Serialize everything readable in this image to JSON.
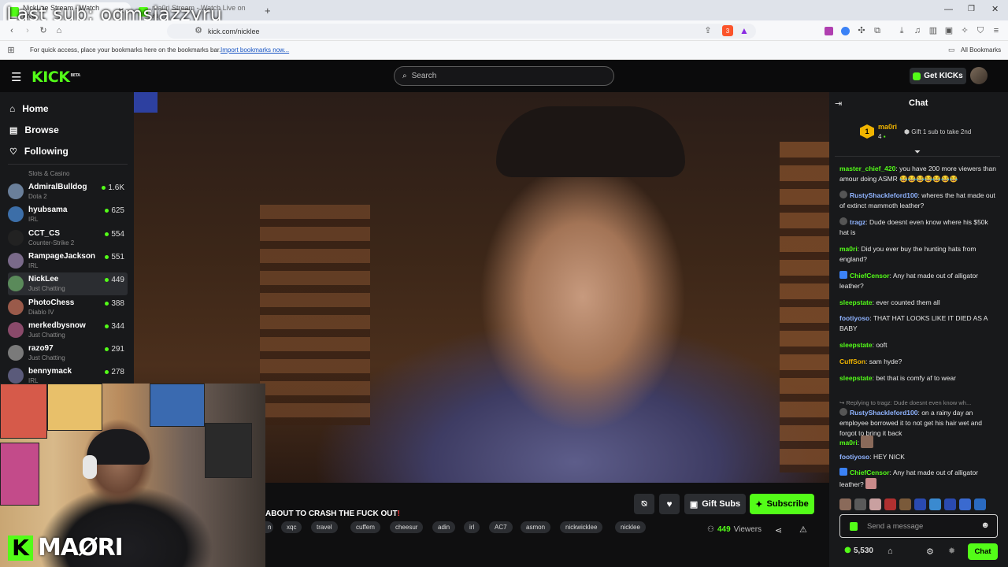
{
  "overlay_text": "Last sub: ogmsjazzyru",
  "browser": {
    "tabs": [
      {
        "title": "NickLee Stream - Watch Live",
        "active": true
      },
      {
        "title": "ma0ri Stream - Watch Live on Ki",
        "active": false
      }
    ],
    "url": "kick.com/nicklee",
    "bookmarks_hint": "For quick access, place your bookmarks here on the bookmarks bar.",
    "bookmarks_link": "Import bookmarks now...",
    "all_bookmarks": "All Bookmarks",
    "brave_badge": "3"
  },
  "header": {
    "logo": "KICK",
    "logo_beta": "BETA",
    "search_placeholder": "Search",
    "get_kicks": "Get KICKs"
  },
  "sidebar": {
    "nav": [
      {
        "label": "Home",
        "icon": "home-icon"
      },
      {
        "label": "Browse",
        "icon": "browse-icon"
      },
      {
        "label": "Following",
        "icon": "heart-icon"
      }
    ],
    "partial_category": "Slots & Casino",
    "channels": [
      {
        "name": "AdmiralBulldog",
        "category": "Dota 2",
        "viewers": "1.6K",
        "color": "#6a7f9a"
      },
      {
        "name": "hyubsama",
        "category": "IRL",
        "viewers": "625",
        "color": "#3c6ea8"
      },
      {
        "name": "CCT_CS",
        "category": "Counter-Strike 2",
        "viewers": "554",
        "color": "#222222"
      },
      {
        "name": "RampageJackson",
        "category": "IRL",
        "viewers": "551",
        "color": "#7a6a8a"
      },
      {
        "name": "NickLee",
        "category": "Just Chatting",
        "viewers": "449",
        "color": "#5a8a5a",
        "active": true
      },
      {
        "name": "PhotoChess",
        "category": "Diablo IV",
        "viewers": "388",
        "color": "#9a5a4a"
      },
      {
        "name": "merkedbysnow",
        "category": "Just Chatting",
        "viewers": "344",
        "color": "#8a4a6a"
      },
      {
        "name": "razo97",
        "category": "Just Chatting",
        "viewers": "291",
        "color": "#7a7a7a"
      },
      {
        "name": "bennymack",
        "category": "IRL",
        "viewers": "278",
        "color": "#5a5a7a"
      }
    ]
  },
  "stream": {
    "title_prefix": "ABOUT TO CRASH THE FUCK OUT",
    "title_suffix": "!",
    "tags": [
      "n",
      "xqc",
      "travel",
      "cuffem",
      "cheesur",
      "adin",
      "irl",
      "AC7",
      "asmon",
      "nickwicklee",
      "nicklee"
    ],
    "gift_subs": "Gift Subs",
    "subscribe": "Subscribe",
    "viewers": "449",
    "viewers_label": "Viewers"
  },
  "webcam": {
    "logo_letter": "K",
    "logo_text": "MAØRI"
  },
  "chat": {
    "title": "Chat",
    "pinned": {
      "user": "ma0ri",
      "count": "4",
      "rank": "1",
      "text": "Gift 1 sub to take 2nd"
    },
    "messages": [
      {
        "user": "master_chief_420",
        "color": "#53fc18",
        "text": "you have 200 more viewers than amour doing ASMR 😂😂😂😂😂😂😂"
      },
      {
        "user": "RustyShackleford100",
        "color": "#8fb3ff",
        "text": "wheres the hat made out of extinct mammoth leather?"
      },
      {
        "user": "tragz",
        "color": "#8fb3ff",
        "text": "Dude doesnt even know where his $50k hat is"
      },
      {
        "user": "ma0ri",
        "color": "#53fc18",
        "text": "Did you ever buy the hunting hats from england?"
      },
      {
        "user": "ChiefCensor",
        "color": "#53fc18",
        "text": "Any hat made out of alligator leather?"
      },
      {
        "user": "sleepstate",
        "color": "#53fc18",
        "text": "ever counted them all"
      },
      {
        "user": "footiyoso",
        "color": "#8fb3ff",
        "text": "THAT HAT LOOKS LIKE IT DIED AS A BABY"
      },
      {
        "user": "sleepstate",
        "color": "#53fc18",
        "text": "ooft"
      },
      {
        "user": "CuffSon",
        "color": "#f0b400",
        "text": "sam hyde?"
      },
      {
        "user": "sleepstate",
        "color": "#53fc18",
        "text": "bet that is comfy af to wear"
      },
      {
        "user": "RustyShackleford100",
        "color": "#8fb3ff",
        "text": "on a rainy day an employee borrowed it to not get his hair wet and forgot to bring it back",
        "reply": "Replying to tragz: Dude doesnt even know wh..."
      },
      {
        "user": "ma0ri",
        "color": "#53fc18",
        "text": ""
      },
      {
        "user": "footiyoso",
        "color": "#8fb3ff",
        "text": "HEY NICK"
      },
      {
        "user": "ChiefCensor",
        "color": "#53fc18",
        "text": "Any hat made out of alligator leather?"
      }
    ],
    "input_placeholder": "Send a message",
    "points": "5,530",
    "send_label": "Chat"
  }
}
